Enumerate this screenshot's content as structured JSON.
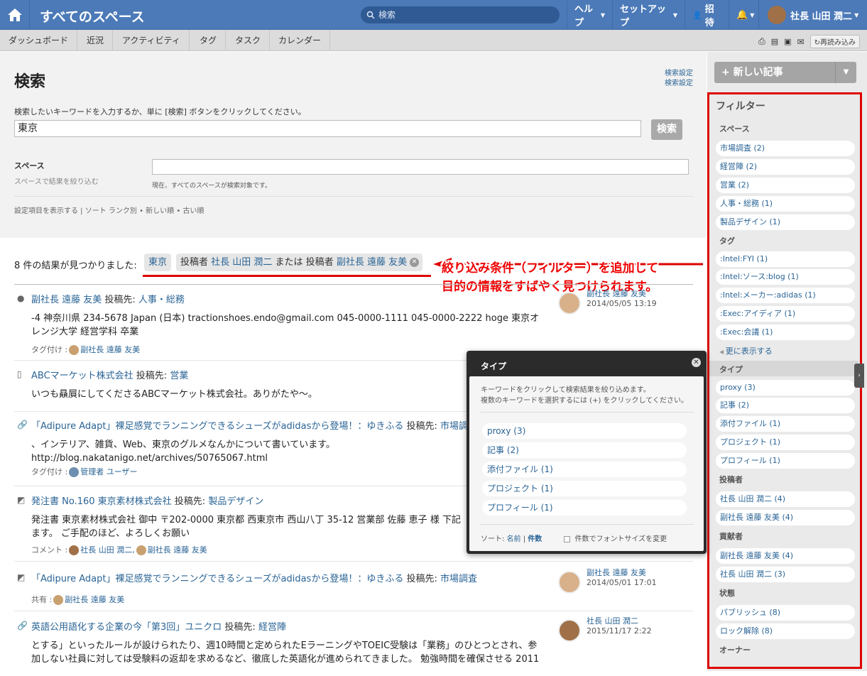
{
  "header": {
    "title": "すべてのスペース",
    "search_placeholder": "検索",
    "help": "ヘルプ",
    "setup": "セットアップ",
    "invite": "招待",
    "user": "社長 山田 潤二"
  },
  "subnav": {
    "tabs": [
      "ダッシュボード",
      "近況",
      "アクティビティ",
      "タグ",
      "タスク",
      "カレンダー"
    ],
    "reload": "再読み込み"
  },
  "page": {
    "title": "検索",
    "settings1": "検索設定",
    "settings2": "検索設定",
    "instruction": "検索したいキーワードを入力するか、単に [検索] ボタンをクリックしてください。",
    "keyword": "東京",
    "search_button": "検索",
    "space_label": "スペース",
    "space_hint": "スペースで結果を絞り込む",
    "space_note": "現在、すべてのスペースが検索対象です。",
    "sort_line": "設定項目を表示する | ソート ランク別 • 新しい順 • 古い順"
  },
  "results": {
    "count_text": "8 件の結果が見つかりました:",
    "chip1": "東京",
    "chip2_prefix": "投稿者 ",
    "chip2_a": "社長 山田 潤二",
    "chip2_mid": " または 投稿者 ",
    "chip2_b": "副社長 遠藤 友美"
  },
  "annotation": {
    "line1": "絞り込み条件（フィルター）を追加して",
    "line2": "目的の情報をすばやく見つけられます。"
  },
  "items": [
    {
      "title": "副社長 遠藤 友美",
      "post_to_label": " 投稿先: ",
      "post_to": "人事・総務",
      "body1": "-4 神奈川県 234-5678 Japan (日本) tractionshoes.endo@gmail.com 045-0000-1111 045-0000-2222 hoge 東京オ",
      "body2": "レンジ大学 経営学科 卒業",
      "tag_label": "タグ付け :",
      "tag_user": "副社長 遠藤 友美",
      "meta_user": "副社長 遠藤 友美",
      "meta_date": "2014/05/05 13:19"
    },
    {
      "title": "ABCマーケット株式会社",
      "post_to_label": " 投稿先: ",
      "post_to": "営業",
      "body1": "いつも贔屓にしてくださるABCマーケット株式会社。ありがたや～。"
    },
    {
      "title": "「Adipure Adapt」裸足感覚でランニングできるシューズがadidasから登場！：ゆきふる",
      "post_to_label": " 投稿先: ",
      "post_to": "市場調",
      "body1": "、インテリア、雑貨、Web、東京のグルメなんかについて書いています。",
      "body2": "http://blog.nakatanigo.net/archives/50765067.html",
      "tag_label": "タグ付け :",
      "tag_user": "管理者 ユーザー"
    },
    {
      "title": "発注書 No.160 東京素材株式会社",
      "post_to_label": " 投稿先: ",
      "post_to": "製品デザイン",
      "body1": "発注書 東京素材株式会社 御中 〒202-0000 東京都 西東京市 西山八丁 35-12 営業部 佐藤 恵子 様 下記",
      "body2": "ます。 ご手配のほど、よろしくお願い",
      "tag_label": "コメント :",
      "tag_user": "社長 山田 潤二,",
      "tag_user2": "副社長 遠藤 友美"
    },
    {
      "title": "「Adipure Adapt」裸足感覚でランニングできるシューズがadidasから登場！：ゆきふる",
      "post_to_label": " 投稿先: ",
      "post_to": "市場調査",
      "tag_label": "共有 :",
      "tag_user": "副社長 遠藤 友美",
      "meta_user": "副社長 遠藤 友美",
      "meta_date": "2014/05/01 17:01"
    },
    {
      "title": "英語公用語化する企業の今「第3回」ユニクロ",
      "post_to_label": " 投稿先: ",
      "post_to": "経営陣",
      "body1": "とする」といったルールが設けられたり、週10時間と定められたEラーニングやTOEIC受験は「業務」のひとつとされ、参",
      "body2": "加しない社員に対しては受験料の返却を求めるなど、徹底した英語化が進められてきました。 勉強時間を確保させる 2011",
      "meta_user": "社長 山田 潤二",
      "meta_date": "2015/11/17 2:22"
    }
  ],
  "sidebar": {
    "new_button": "新しい記事",
    "filter_title": "フィルター",
    "space_title": "スペース",
    "spaces": [
      "市場調査 (2)",
      "経営陣 (2)",
      "営業 (2)",
      "人事・総務 (1)",
      "製品デザイン (1)"
    ],
    "tag_title": "タグ",
    "tags": [
      ":Intel:FYI (1)",
      ":Intel:ソース:blog (1)",
      ":Intel:メーカー:adidas (1)",
      ":Exec:アイディア (1)",
      ":Exec:会議 (1)"
    ],
    "more": "更に表示する",
    "type_title": "タイプ",
    "types": [
      "proxy (3)",
      "記事 (2)",
      "添付ファイル (1)",
      "プロジェクト (1)",
      "プロフィール (1)"
    ],
    "poster_title": "投稿者",
    "posters": [
      "社長 山田 潤二 (4)",
      "副社長 遠藤 友美 (4)"
    ],
    "contrib_title": "貢献者",
    "contribs": [
      "副社長 遠藤 友美 (4)",
      "社長 山田 潤二 (3)"
    ],
    "state_title": "状態",
    "states": [
      "パブリッシュ (8)",
      "ロック解除 (8)"
    ],
    "owner_title": "オーナー"
  },
  "panel": {
    "title": "タイプ",
    "desc1": "キーワードをクリックして検索結果を絞り込めます。",
    "desc2": "複数のキーワードを選択するには (+) をクリックしてください。",
    "items": [
      "proxy (3)",
      "記事 (2)",
      "添付ファイル (1)",
      "プロジェクト (1)",
      "プロフィール (1)"
    ],
    "sort_label": "ソート: ",
    "sort_name": "名前",
    "sort_sep": " | ",
    "sort_count": "件数",
    "font_option": "件数でフォントサイズを変更"
  }
}
